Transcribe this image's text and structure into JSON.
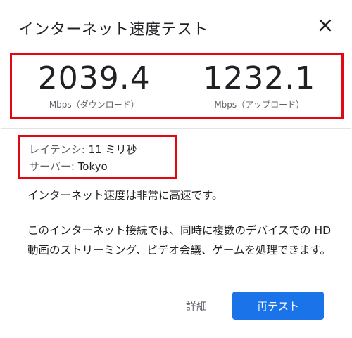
{
  "dialog": {
    "title": "インターネット速度テスト",
    "close_icon": "close-icon"
  },
  "speed": {
    "download": {
      "value": "2039.4",
      "unit": "Mbps（ダウンロード）"
    },
    "upload": {
      "value": "1232.1",
      "unit": "Mbps（アップロード）"
    }
  },
  "latency": {
    "label": "レイテンシ:",
    "value": "11 ミリ秒",
    "server_label": "サーバー:",
    "server_value": "Tokyo"
  },
  "messages": {
    "summary": "インターネット速度は非常に高速です。",
    "detail": "このインターネット接続では、同時に複数のデバイスでの HD 動画のストリーミング、ビデオ会議、ゲームを処理できます。"
  },
  "actions": {
    "details_label": "詳細",
    "retest_label": "再テスト"
  },
  "colors": {
    "accent": "#1a73e8",
    "highlight": "#e30613"
  }
}
